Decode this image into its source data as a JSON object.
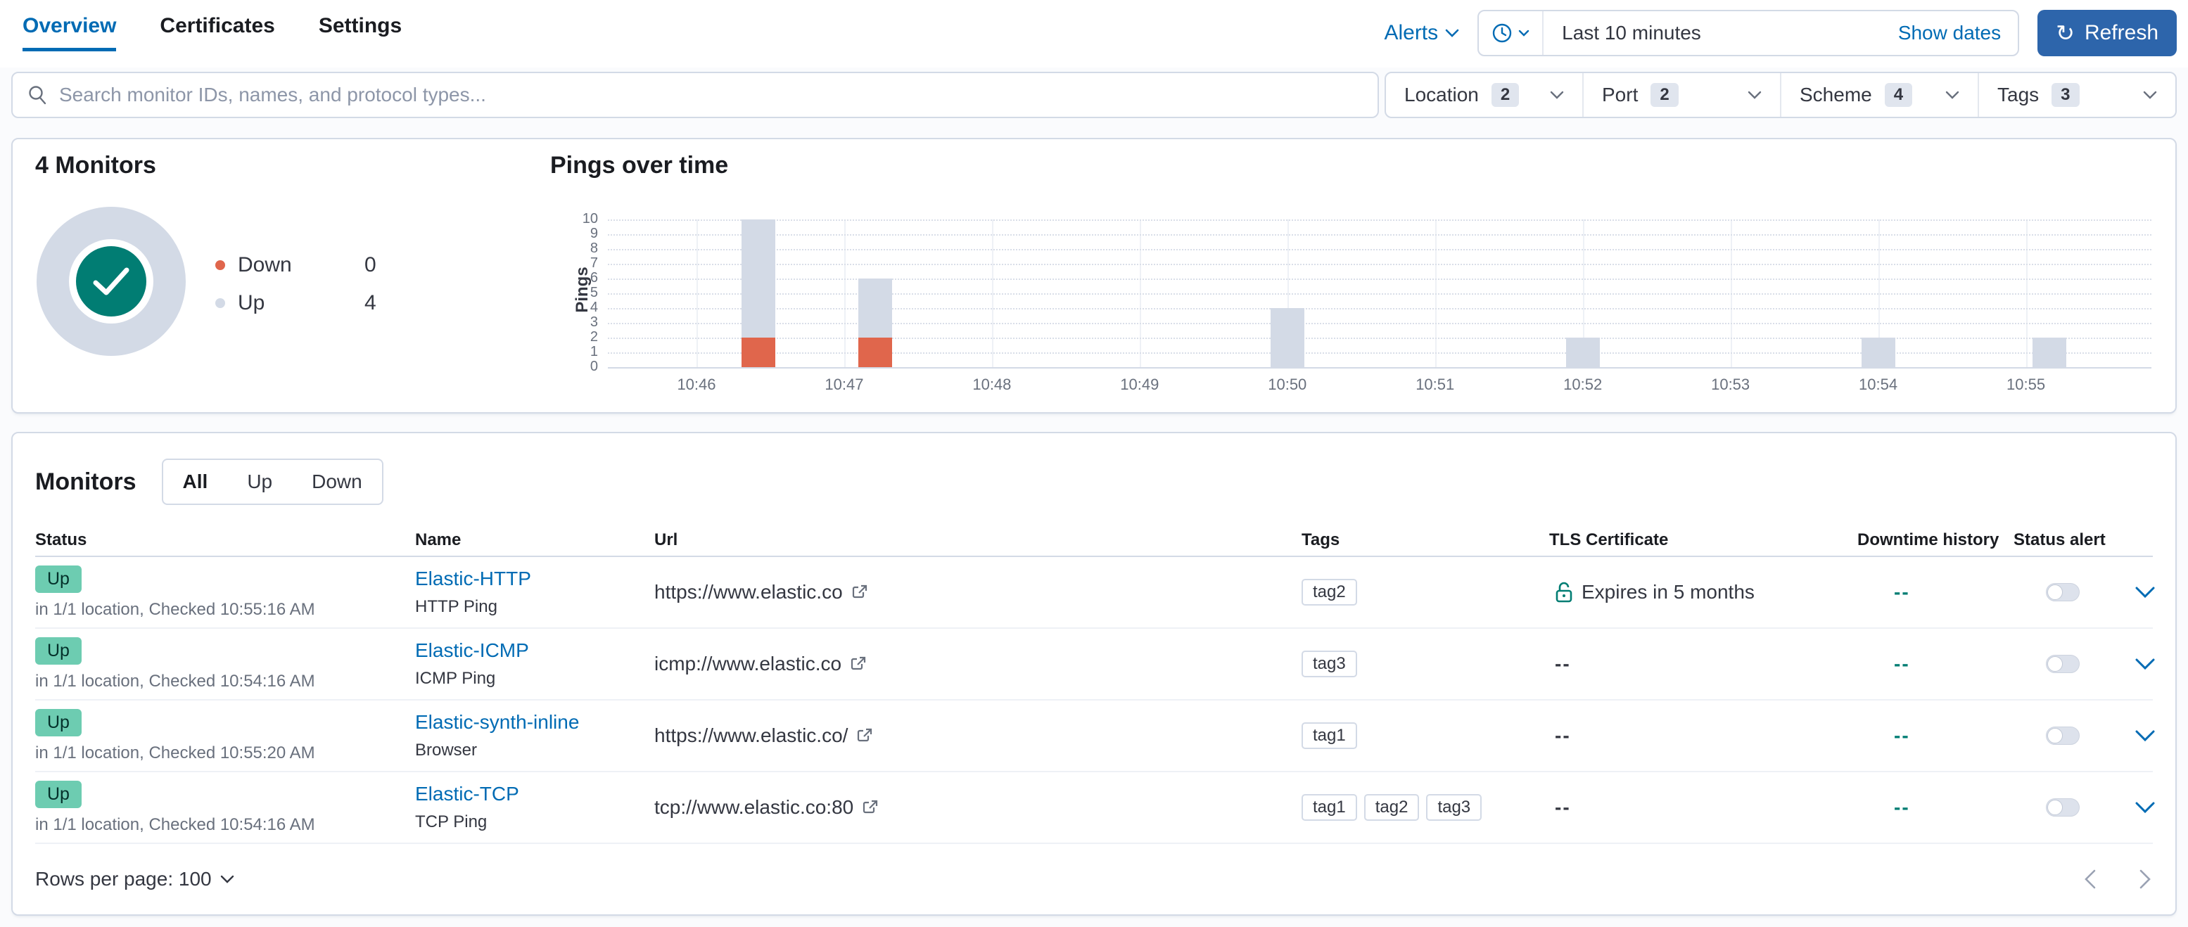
{
  "header": {
    "tabs": [
      {
        "label": "Overview",
        "active": true
      },
      {
        "label": "Certificates",
        "active": false
      },
      {
        "label": "Settings",
        "active": false
      }
    ],
    "alerts_label": "Alerts",
    "time_range": "Last 10 minutes",
    "show_dates_label": "Show dates",
    "refresh_label": "Refresh"
  },
  "search": {
    "placeholder": "Search monitor IDs, names, and protocol types..."
  },
  "filters": [
    {
      "label": "Location",
      "count": "2"
    },
    {
      "label": "Port",
      "count": "2"
    },
    {
      "label": "Scheme",
      "count": "4"
    },
    {
      "label": "Tags",
      "count": "3"
    }
  ],
  "colors": {
    "primary": "#006bb4",
    "refresh_button": "#2d65ab",
    "up_gray": "#d3dae6",
    "down_orange": "#e0664c",
    "teal": "#017d73",
    "badge_green": "#6dccb1"
  },
  "chart_data": [
    {
      "type": "pie",
      "title": "4 Monitors",
      "slices": [
        {
          "label": "Down",
          "value": 0,
          "color": "#e0664c"
        },
        {
          "label": "Up",
          "value": 4,
          "color": "#d3dae6"
        }
      ],
      "center_icon": "check",
      "legend_position": "right"
    },
    {
      "type": "bar",
      "title": "Pings over time",
      "ylabel": "Pings",
      "ylim": [
        0,
        10
      ],
      "yticks": [
        0,
        1,
        2,
        3,
        4,
        5,
        6,
        7,
        8,
        9,
        10
      ],
      "x_domain_minutes": [
        45.4,
        55.85
      ],
      "xticks": [
        {
          "label": "10:46",
          "minute": 46
        },
        {
          "label": "10:47",
          "minute": 47
        },
        {
          "label": "10:48",
          "minute": 48
        },
        {
          "label": "10:49",
          "minute": 49
        },
        {
          "label": "10:50",
          "minute": 50
        },
        {
          "label": "10:51",
          "minute": 51
        },
        {
          "label": "10:52",
          "minute": 52
        },
        {
          "label": "10:53",
          "minute": 53
        },
        {
          "label": "10:54",
          "minute": 54
        },
        {
          "label": "10:55",
          "minute": 55
        }
      ],
      "stacked": true,
      "series": [
        {
          "name": "Down",
          "color": "#e0664c"
        },
        {
          "name": "Up",
          "color": "#d3dae6"
        }
      ],
      "bars": [
        {
          "minute": 46.42,
          "Down": 2,
          "Up": 8
        },
        {
          "minute": 47.21,
          "Down": 2,
          "Up": 4
        },
        {
          "minute": 50.0,
          "Down": 0,
          "Up": 4
        },
        {
          "minute": 52.0,
          "Down": 0,
          "Up": 2
        },
        {
          "minute": 54.0,
          "Down": 0,
          "Up": 2
        },
        {
          "minute": 55.16,
          "Down": 0,
          "Up": 2
        }
      ],
      "grid": true,
      "legend_position": "none"
    }
  ],
  "monitors": {
    "title": "Monitors",
    "status_tabs": [
      {
        "label": "All",
        "selected": true
      },
      {
        "label": "Up",
        "selected": false
      },
      {
        "label": "Down",
        "selected": false
      }
    ],
    "columns": [
      "Status",
      "Name",
      "Url",
      "Tags",
      "TLS Certificate",
      "Downtime history",
      "Status alert"
    ],
    "rows": [
      {
        "status": "Up",
        "status_detail": "in 1/1 location, Checked 10:55:16 AM",
        "name": "Elastic-HTTP",
        "type": "HTTP Ping",
        "url": "https://www.elastic.co",
        "tags": [
          "tag2"
        ],
        "tls": "Expires in 5 months",
        "tls_lock": true,
        "downtime": "--",
        "alert_on": false
      },
      {
        "status": "Up",
        "status_detail": "in 1/1 location, Checked 10:54:16 AM",
        "name": "Elastic-ICMP",
        "type": "ICMP Ping",
        "url": "icmp://www.elastic.co",
        "tags": [
          "tag3"
        ],
        "tls": "--",
        "tls_lock": false,
        "downtime": "--",
        "alert_on": false
      },
      {
        "status": "Up",
        "status_detail": "in 1/1 location, Checked 10:55:20 AM",
        "name": "Elastic-synth-inline",
        "type": "Browser",
        "url": "https://www.elastic.co/",
        "tags": [
          "tag1"
        ],
        "tls": "--",
        "tls_lock": false,
        "downtime": "--",
        "alert_on": false
      },
      {
        "status": "Up",
        "status_detail": "in 1/1 location, Checked 10:54:16 AM",
        "name": "Elastic-TCP",
        "type": "TCP Ping",
        "url": "tcp://www.elastic.co:80",
        "tags": [
          "tag1",
          "tag2",
          "tag3"
        ],
        "tls": "--",
        "tls_lock": false,
        "downtime": "--",
        "alert_on": false
      }
    ],
    "rows_per_page_label": "Rows per page: 100"
  }
}
